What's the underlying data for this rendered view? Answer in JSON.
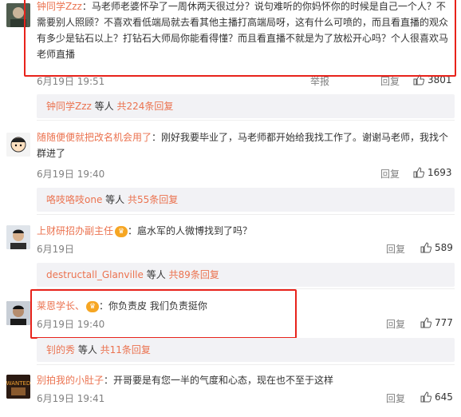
{
  "comments": [
    {
      "user": "钟同学Zzz",
      "text": "：马老师老婆怀孕了一周休两天很过分？说句难听的你妈怀你的时候是自己一个人？不需要别人照顾？不喜欢看低端局就去看其他主播打高端局呀，这有什么可喷的，而且看直播的观众有多少是钻石以上？打钻石大师局你能看得懂？而且看直播不就是为了放松开心吗？个人很喜欢马老师直播",
      "time": "6月19日 19:51",
      "report": "举报",
      "reply": "回复",
      "likes": "3801",
      "sub_user": "钟同学Zzz",
      "sub_mid": " 等人 ",
      "sub_count": "共224条回复"
    },
    {
      "user": "随随便便就把改名机会用了",
      "text": "：刚好我要毕业了，马老师都开始给我找工作了。谢谢马老师，我找个群进了",
      "time": "6月19日 19:40",
      "reply": "回复",
      "likes": "1693",
      "sub_user": "咯吱咯吱one",
      "sub_mid": " 等人 ",
      "sub_count": "共55条回复"
    },
    {
      "user": "上财研招办副主任",
      "text": "：扈水军的人微博找到了吗？",
      "time": "6月19日",
      "reply": "回复",
      "likes": "589",
      "sub_user": "destructall_Glanville",
      "sub_mid": " 等人 ",
      "sub_count": "共89条回复"
    },
    {
      "user": "莱恩学长、",
      "text": "：你负责皮 我们负责挺你",
      "time": "6月19日 19:40",
      "reply": "回复",
      "likes": "777",
      "sub_user": "钊的秀",
      "sub_mid": " 等人 ",
      "sub_count": "共11条回复"
    },
    {
      "user": "别拍我的小肚子",
      "text": "：开哥要是有您一半的气度和心态，现在也不至于这样",
      "time": "6月19日 19:41",
      "reply": "回复",
      "likes": "645"
    }
  ],
  "colors": {
    "username": "#eb7350",
    "highlight_box": "#e8231b"
  },
  "icons": {
    "like": "thumbs-up-icon",
    "badge": "vip-badge-icon"
  }
}
